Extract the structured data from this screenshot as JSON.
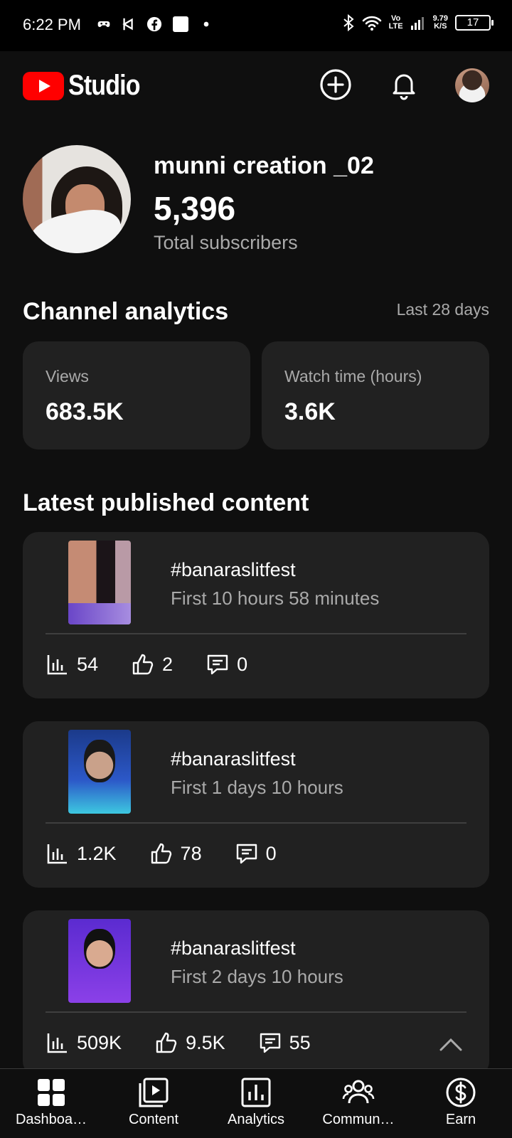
{
  "status_bar": {
    "time": "6:22 PM",
    "network_top": "Vo",
    "network_bottom": "LTE",
    "speed_top": "9.79",
    "speed_bottom": "K/S",
    "battery": "17",
    "left_icons": [
      "game-controller-icon",
      "bixby-icon",
      "facebook-icon",
      "square-icon",
      "dot-icon"
    ],
    "right_icons": [
      "bluetooth-icon",
      "wifi-icon",
      "signal-icon",
      "battery-icon"
    ]
  },
  "header": {
    "app_name": "Studio",
    "icons": [
      "youtube-logo-icon",
      "create-icon",
      "notifications-icon",
      "account-avatar"
    ]
  },
  "channel": {
    "name": "munni creation _02",
    "subscribers": "5,396",
    "subscribers_label": "Total subscribers"
  },
  "analytics": {
    "title": "Channel analytics",
    "period": "Last 28 days",
    "stats": [
      {
        "label": "Views",
        "value": "683.5K"
      },
      {
        "label": "Watch time (hours)",
        "value": "3.6K"
      }
    ]
  },
  "latest": {
    "title": "Latest published content",
    "items": [
      {
        "title": "#banaraslitfest",
        "subtitle": "First 10 hours 58 minutes",
        "views": "54",
        "likes": "2",
        "comments": "0"
      },
      {
        "title": "#banaraslitfest",
        "subtitle": "First 1 days 10 hours",
        "views": "1.2K",
        "likes": "78",
        "comments": "0"
      },
      {
        "title": "#banaraslitfest",
        "subtitle": "First 2 days 10 hours",
        "views": "509K",
        "likes": "9.5K",
        "comments": "55"
      }
    ]
  },
  "nav": {
    "items": [
      {
        "label": "Dashboa…",
        "icon": "dashboard-icon"
      },
      {
        "label": "Content",
        "icon": "content-icon"
      },
      {
        "label": "Analytics",
        "icon": "analytics-icon"
      },
      {
        "label": "Commun…",
        "icon": "community-icon"
      },
      {
        "label": "Earn",
        "icon": "earn-icon"
      }
    ]
  },
  "colors": {
    "background": "#0f0f0f",
    "card": "#212121",
    "secondary_text": "#aaaaaa",
    "brand_red": "#ff0000"
  }
}
